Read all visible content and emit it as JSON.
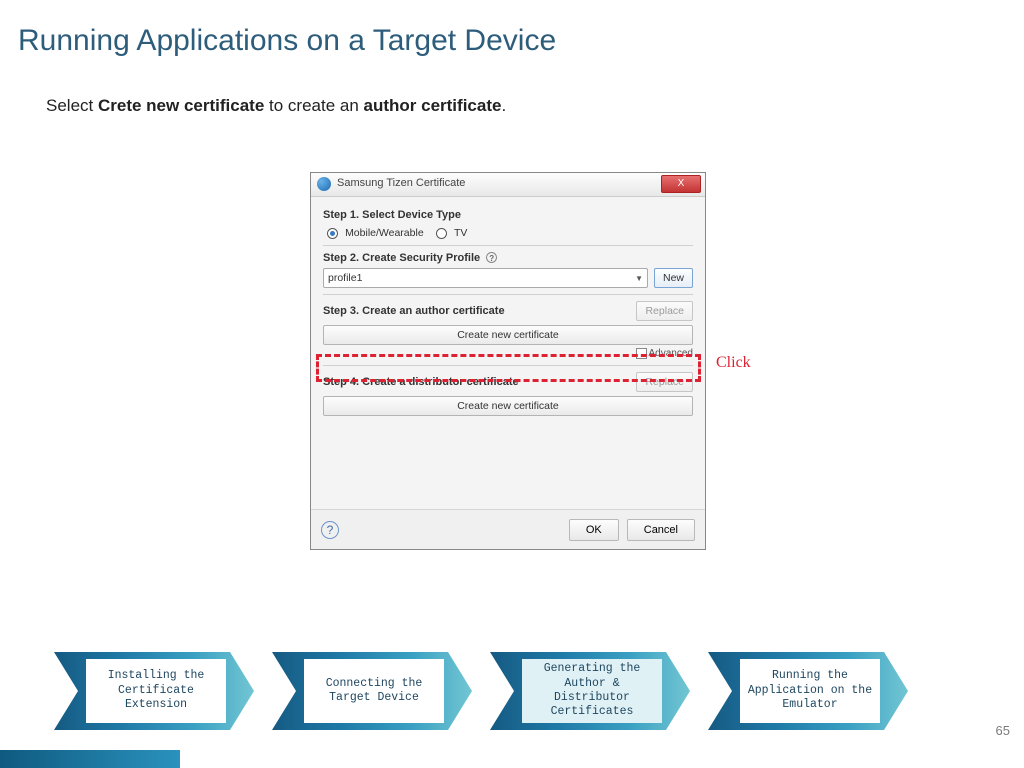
{
  "title": "Running Applications on a Target Device",
  "instruction": {
    "pre": "Select ",
    "b1": "Crete new certificate",
    "mid": " to create an ",
    "b2": "author certificate",
    "post": "."
  },
  "dialog": {
    "title": "Samsung Tizen Certificate",
    "close": "X",
    "step1": "Step 1.  Select Device Type",
    "radio1": "Mobile/Wearable",
    "radio2": "TV",
    "step2": "Step 2.  Create Security Profile",
    "profile_value": "profile1",
    "new_btn": "New",
    "step3": "Step 3.  Create an author certificate",
    "replace_btn": "Replace",
    "create_btn": "Create new certificate",
    "advanced": "Advanced",
    "step4": "Step 4.  Create a distributor certificate",
    "ok": "OK",
    "cancel": "Cancel"
  },
  "click_label": "Click",
  "steps": [
    "Installing the Certificate Extension",
    "Connecting the Target Device",
    "Generating the Author & Distributor Certificates",
    "Running the Application on the Emulator"
  ],
  "page_number": "65"
}
